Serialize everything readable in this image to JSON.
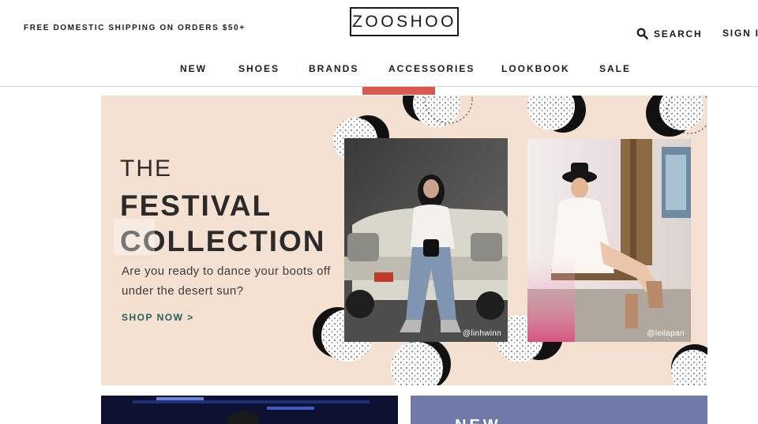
{
  "header": {
    "shipping_notice": "FREE DOMESTIC SHIPPING ON ORDERS $50+",
    "logo": "ZOOSHOO",
    "search_label": "SEARCH",
    "sign_in_label": "SIGN I"
  },
  "nav": {
    "items": [
      "NEW",
      "SHOES",
      "BRANDS",
      "ACCESSORIES",
      "LOOKBOOK",
      "SALE"
    ]
  },
  "hero": {
    "title_small": "THE",
    "title_line1": "FESTIVAL",
    "title_line2": "COLLECTION",
    "subtitle": "Are you ready to dance your boots off under the desert sun?",
    "cta": "SHOP NOW >",
    "photos": [
      {
        "credit": "@linhwinn"
      },
      {
        "credit": "@leilapari"
      }
    ]
  },
  "tiles": {
    "second_heading": "NEW"
  },
  "colors": {
    "hero_background": "#f5e1d2",
    "cta": "#24605a",
    "nav_indicator": "#d9584f",
    "tile_blue": "#6f7aa8"
  }
}
